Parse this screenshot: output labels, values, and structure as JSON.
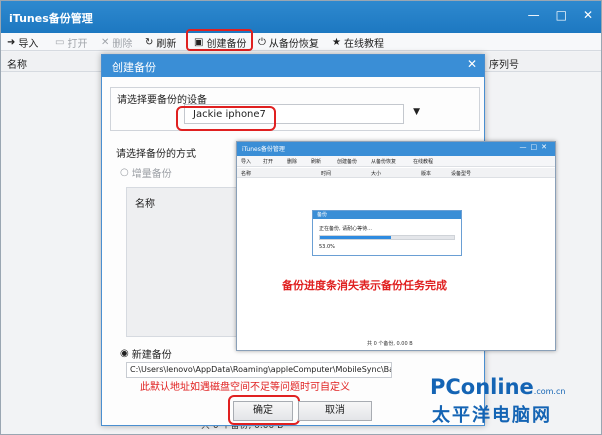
{
  "main_window": {
    "title": "iTunes备份管理",
    "window_buttons": [
      "—",
      "□",
      "✕"
    ],
    "toolbar": {
      "import": "导入",
      "open": "打开",
      "delete": "删除",
      "refresh": "刷新",
      "create_backup": "创建备份",
      "restore": "从备份恢复",
      "tutorial": "在线教程"
    },
    "columns": {
      "name": "名称",
      "serial": "序列号"
    },
    "status": "共 0 个备份, 0.00 B"
  },
  "dialog": {
    "title": "创建备份",
    "device_group_label": "请选择要备份的设备",
    "device_value": "Jackie iphone7",
    "mode_label": "请选择备份的方式",
    "incremental_label": "增量备份",
    "list_header": "名称",
    "new_backup_label": "新建备份",
    "path": "C:\\Users\\lenovo\\AppData\\Roaming\\appleComputer\\MobileSync\\Backup",
    "path_note": "此默认地址如遇磁盘空间不足等问题时可自定义",
    "ok": "确定",
    "cancel": "取消"
  },
  "inset": {
    "title": "iTunes备份管理",
    "toolbar": [
      "导入",
      "打开",
      "删除",
      "刷新",
      "创建备份",
      "从备份恢复",
      "在线教程"
    ],
    "columns": [
      "名称",
      "时间",
      "大小",
      "版本",
      "设备型号"
    ],
    "progress_dialog_title": "备份",
    "progress_message": "正在备份, 请耐心等待...",
    "progress_value": 0.53,
    "progress_label": "53.0%",
    "status": "共 0 个备份, 0.00 B",
    "caption": "备份进度条消失表示备份任务完成"
  },
  "watermark": {
    "brand": "PConline",
    "domain": ".com.cn",
    "chinese": "太平洋电脑网"
  },
  "colors": {
    "title_bar": "#2e89cf",
    "highlight": "#e02020",
    "watermark": "#1464b4"
  }
}
